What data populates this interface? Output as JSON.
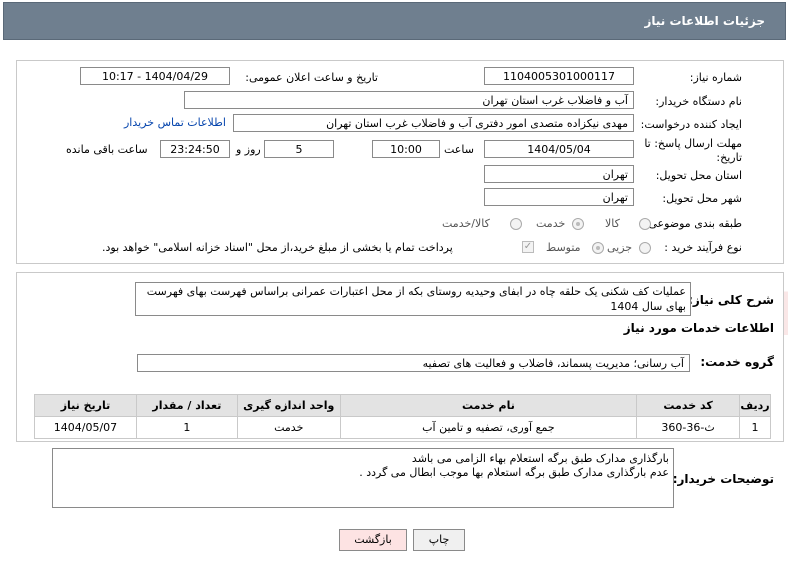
{
  "header": {
    "title": "جزئیات اطلاعات نیاز"
  },
  "fields": {
    "need_number_label": "شماره نیاز:",
    "need_number": "1104005301000117",
    "announce_label": "تاریخ و ساعت اعلان عمومی:",
    "announce_value": "1404/04/29 - 10:17",
    "buyer_org_label": "نام دستگاه خریدار:",
    "buyer_org": "آب و فاضلاب غرب استان تهران",
    "creator_label": "ایجاد کننده درخواست:",
    "creator": "مهدی نیکزاده متصدی امور دفتری آب و فاضلاب غرب استان تهران",
    "contact_link": "اطلاعات تماس خریدار",
    "deadline_label_1": "مهلت ارسال پاسخ: تا",
    "deadline_label_2": "تاریخ:",
    "deadline_date": "1404/05/04",
    "time_label": "ساعت",
    "deadline_time": "10:00",
    "days": "5",
    "days_label": "روز و",
    "remaining_time": "23:24:50",
    "remaining_label": "ساعت باقی مانده",
    "province_label": "استان محل تحویل:",
    "province": "تهران",
    "city_label": "شهر محل تحویل:",
    "city": "تهران",
    "category_label": "طبقه بندی موضوعی:",
    "category_options": [
      "کالا",
      "خدمت",
      "کالا/خدمت"
    ],
    "process_label": "نوع فرآیند خرید :",
    "process_options": [
      "جزیی",
      "متوسط"
    ],
    "payment_note": "پرداخت تمام یا بخشی از مبلغ خرید،از محل \"اسناد خزانه اسلامی\" خواهد بود."
  },
  "description": {
    "label": "شرح کلی نیاز:",
    "text": "عملیات کف شکنی یک حلقه چاه در ابفای وحیدیه روستای بکه از محل اعتبارات عمرانی براساس فهرست بهای فهرست بهای سال 1404"
  },
  "services": {
    "section_title": "اطلاعات خدمات مورد نیاز",
    "group_label": "گروه خدمت:",
    "group_value": "آب رسانی؛ مدیریت پسماند، فاضلاب و فعالیت های تصفیه",
    "columns": [
      "ردیف",
      "کد خدمت",
      "نام خدمت",
      "واحد اندازه گیری",
      "تعداد / مقدار",
      "تاریخ نیاز"
    ],
    "rows": [
      [
        "1",
        "ث-36-360",
        "جمع آوری، تصفیه و تامین آب",
        "خدمت",
        "1",
        "1404/05/07"
      ]
    ]
  },
  "buyer_notes": {
    "label": "توضیحات خریدار:",
    "line1": "بارگذاری مدارک طبق برگه استعلام بهاء الزامی می باشد",
    "line2": "عدم بارگذاری مدارک طبق برگه استعلام بها موجب ابطال می گردد ."
  },
  "buttons": {
    "print": "چاپ",
    "back": "بازگشت"
  },
  "watermark": "AriaTender.neT",
  "colors": {
    "header_bg": "#6f7f8f",
    "link": "#0645ad",
    "back_button_bg": "#fde3e3"
  }
}
